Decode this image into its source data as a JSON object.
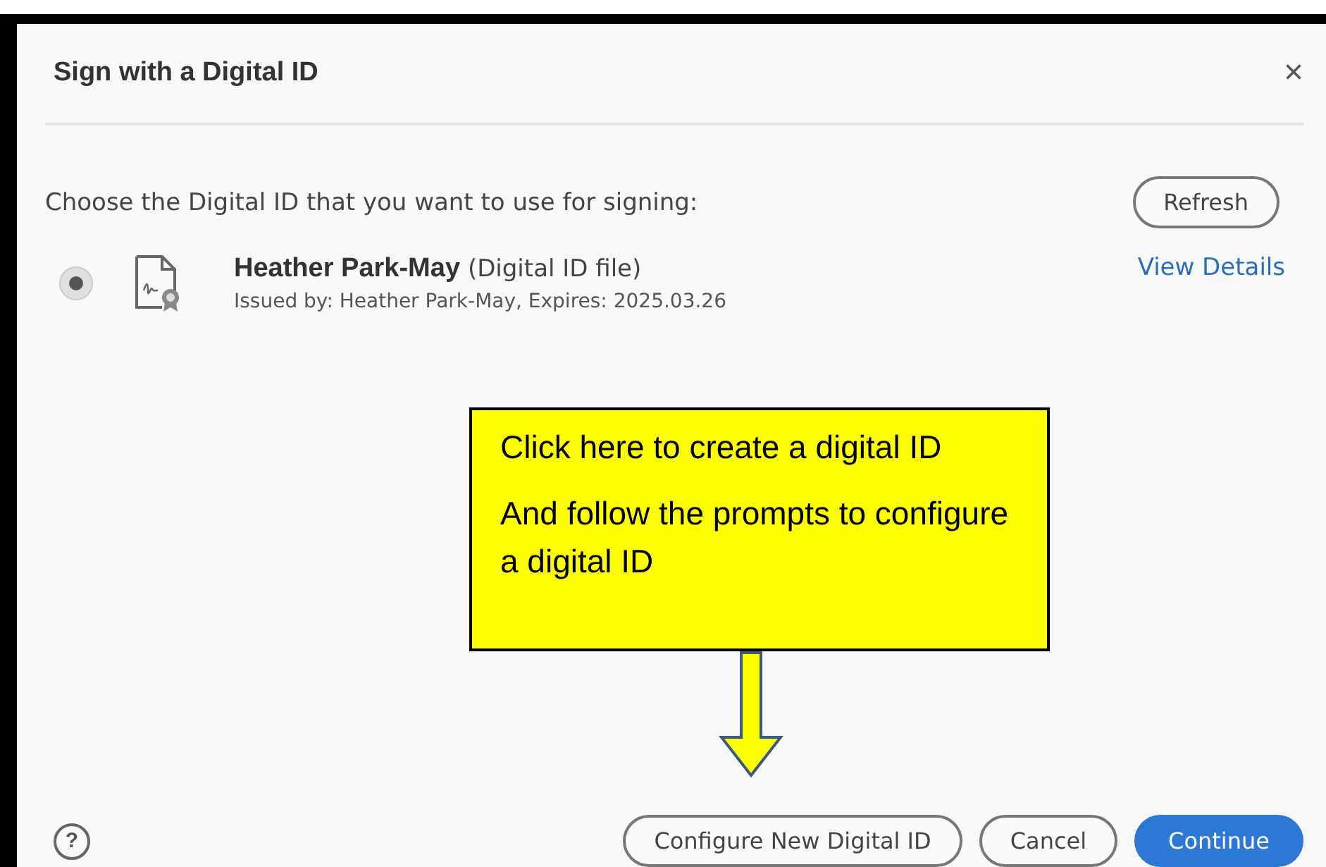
{
  "dialog": {
    "title": "Sign with a Digital ID",
    "close": "×"
  },
  "prompt": "Choose the Digital ID that you want to use for signing:",
  "refresh": "Refresh",
  "ids": [
    {
      "name": "Heather Park-May",
      "type": "(Digital ID file)",
      "issued": "Issued by: Heather Park-May, Expires: 2025.03.26",
      "selected": true,
      "link": "View Details"
    }
  ],
  "callout": {
    "lines": [
      "Click here to create a digital ID",
      "And follow the prompts to configure a digital ID"
    ]
  },
  "footer": {
    "help": "?",
    "buttons": [
      {
        "label": "Configure New Digital ID",
        "kind": "outline"
      },
      {
        "label": "Cancel",
        "kind": "outline"
      },
      {
        "label": "Continue",
        "kind": "primary"
      }
    ]
  }
}
